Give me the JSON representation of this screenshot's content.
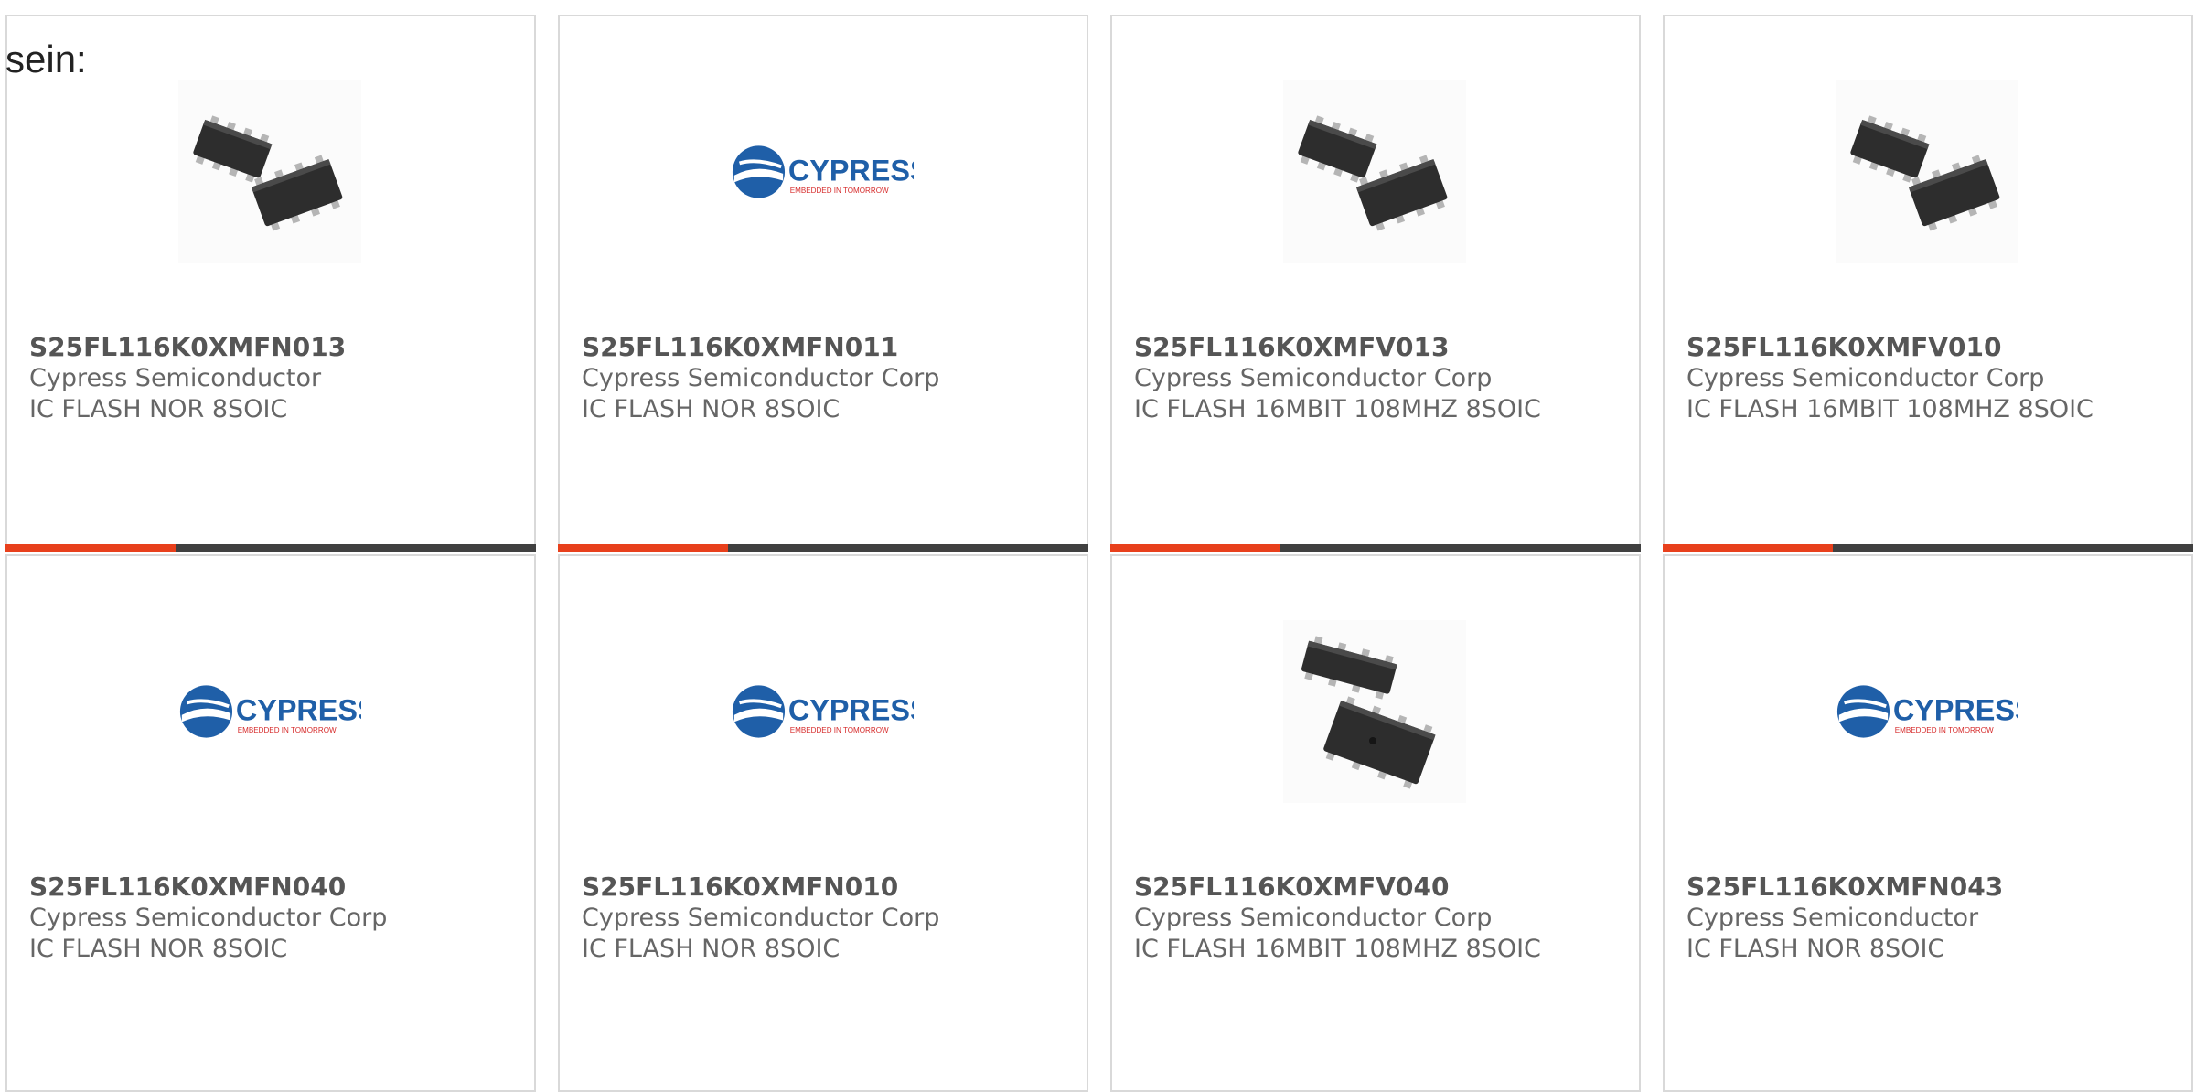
{
  "page_label": "sein:",
  "colors": {
    "bar_accent": "#e8401c",
    "bar_track": "#404040",
    "card_border": "#d9d9d9",
    "cypress_blue": "#1f5fa8",
    "cypress_red": "#d62b2b",
    "chip_body": "#2d2d2d",
    "chip_pins": "#b5b5b5"
  },
  "logo": {
    "wordmark": "CYPRESS",
    "tagline": "EMBEDDED IN TOMORROW"
  },
  "cards": [
    {
      "part_number": "S25FL116K0XMFN013",
      "manufacturer": "Cypress Semiconductor",
      "description": "IC FLASH NOR 8SOIC",
      "image": "chip-pair-icon",
      "accent_fraction": 0.32
    },
    {
      "part_number": "S25FL116K0XMFN011",
      "manufacturer": "Cypress Semiconductor Corp",
      "description": "IC FLASH NOR 8SOIC",
      "image": "cypress-logo",
      "accent_fraction": 0.32
    },
    {
      "part_number": "S25FL116K0XMFV013",
      "manufacturer": "Cypress Semiconductor Corp",
      "description": "IC FLASH 16MBIT 108MHZ 8SOIC",
      "image": "chip-pair-icon",
      "accent_fraction": 0.32
    },
    {
      "part_number": "S25FL116K0XMFV010",
      "manufacturer": "Cypress Semiconductor Corp",
      "description": "IC FLASH 16MBIT 108MHZ 8SOIC",
      "image": "chip-pair-icon",
      "accent_fraction": 0.32
    },
    {
      "part_number": "S25FL116K0XMFN040",
      "manufacturer": "Cypress Semiconductor Corp",
      "description": "IC FLASH NOR 8SOIC",
      "image": "cypress-logo"
    },
    {
      "part_number": "S25FL116K0XMFN010",
      "manufacturer": "Cypress Semiconductor Corp",
      "description": "IC FLASH NOR 8SOIC",
      "image": "cypress-logo"
    },
    {
      "part_number": "S25FL116K0XMFV040",
      "manufacturer": "Cypress Semiconductor Corp",
      "description": "IC FLASH 16MBIT 108MHZ 8SOIC",
      "image": "chip-stack-icon"
    },
    {
      "part_number": "S25FL116K0XMFN043",
      "manufacturer": "Cypress Semiconductor",
      "description": "IC FLASH NOR 8SOIC",
      "image": "cypress-logo"
    }
  ]
}
